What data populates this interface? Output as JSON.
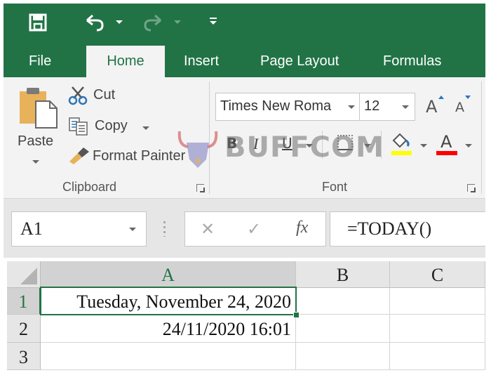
{
  "quick_access": {
    "save_icon": "save-icon",
    "undo_icon": "undo-icon",
    "redo_icon": "redo-icon",
    "customize_icon": "customize-qat-icon"
  },
  "tabs": [
    {
      "label": "File",
      "active": false
    },
    {
      "label": "Home",
      "active": true
    },
    {
      "label": "Insert",
      "active": false
    },
    {
      "label": "Page Layout",
      "active": false
    },
    {
      "label": "Formulas",
      "active": false
    }
  ],
  "ribbon": {
    "clipboard": {
      "paste_label": "Paste",
      "cut_label": "Cut",
      "copy_label": "Copy",
      "format_painter_label": "Format Painter",
      "group_label": "Clipboard"
    },
    "font": {
      "font_name": "Times New Roma",
      "font_size": "12",
      "bold_label": "B",
      "italic_label": "I",
      "underline_label": "U",
      "font_color_label": "A",
      "grow_label": "A",
      "shrink_label": "A",
      "group_label": "Font",
      "highlight_color": "#ffff00",
      "font_color": "#ff0000"
    }
  },
  "formula_bar": {
    "name_box": "A1",
    "cancel_symbol": "✕",
    "enter_symbol": "✓",
    "fx_label": "fx",
    "formula": "=TODAY()"
  },
  "sheet": {
    "columns": [
      "A",
      "B",
      "C"
    ],
    "rows": [
      "1",
      "2",
      "3"
    ],
    "selected_cell": "A1",
    "cells": {
      "A1": "Tuesday, November 24, 2020",
      "A2": "24/11/2020 16:01",
      "A3": "",
      "B1": "",
      "B2": "",
      "B3": "",
      "C1": "",
      "C2": "",
      "C3": ""
    }
  },
  "watermark": {
    "text": "BUFFCOM"
  },
  "colors": {
    "excel_green": "#217346",
    "ribbon_bg": "#f3f3f3",
    "header_bg": "#e6e6e6"
  }
}
